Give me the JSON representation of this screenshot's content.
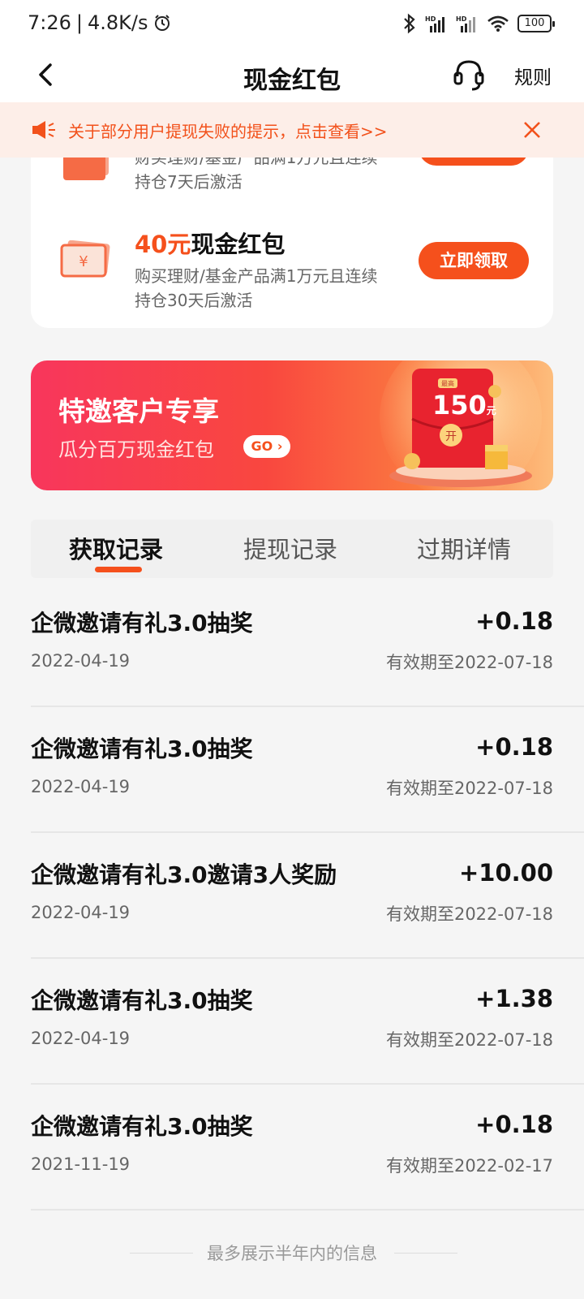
{
  "status_bar": {
    "time": "7:26",
    "speed": "4.8K/s",
    "sim1": "HD",
    "sim2": "HD",
    "battery": "100"
  },
  "nav": {
    "title": "现金红包",
    "rules": "规则"
  },
  "notice": {
    "text": "关于部分用户提现失败的提示，点击查看>>"
  },
  "coupons": {
    "item1": {
      "desc_partial": "财买理财/基金产品满1万元且连续",
      "desc_line2": "持仓7天后激活"
    },
    "item2": {
      "amount": "40元",
      "title": "现金红包",
      "desc_line1": "购买理财/基金产品满1万元且连续",
      "desc_line2": "持仓30天后激活",
      "button": "立即领取"
    }
  },
  "banner": {
    "title": "特邀客户专享",
    "subtitle": "瓜分百万现金红包",
    "go": "GO",
    "badge": "最高",
    "amount": "150",
    "unit": "元",
    "open": "开"
  },
  "tabs": {
    "t1": "获取记录",
    "t2": "提现记录",
    "t3": "过期详情"
  },
  "records": [
    {
      "name": "企微邀请有礼3.0抽奖",
      "date": "2022-04-19",
      "amount": "+0.18",
      "expire": "有效期至2022-07-18"
    },
    {
      "name": "企微邀请有礼3.0抽奖",
      "date": "2022-04-19",
      "amount": "+0.18",
      "expire": "有效期至2022-07-18"
    },
    {
      "name": "企微邀请有礼3.0邀请3人奖励",
      "date": "2022-04-19",
      "amount": "+10.00",
      "expire": "有效期至2022-07-18"
    },
    {
      "name": "企微邀请有礼3.0抽奖",
      "date": "2022-04-19",
      "amount": "+1.38",
      "expire": "有效期至2022-07-18"
    },
    {
      "name": "企微邀请有礼3.0抽奖",
      "date": "2021-11-19",
      "amount": "+0.18",
      "expire": "有效期至2022-02-17"
    }
  ],
  "footer": {
    "note": "最多展示半年内的信息"
  },
  "colors": {
    "accent": "#f5501c",
    "notice_bg": "#fdeee8"
  }
}
